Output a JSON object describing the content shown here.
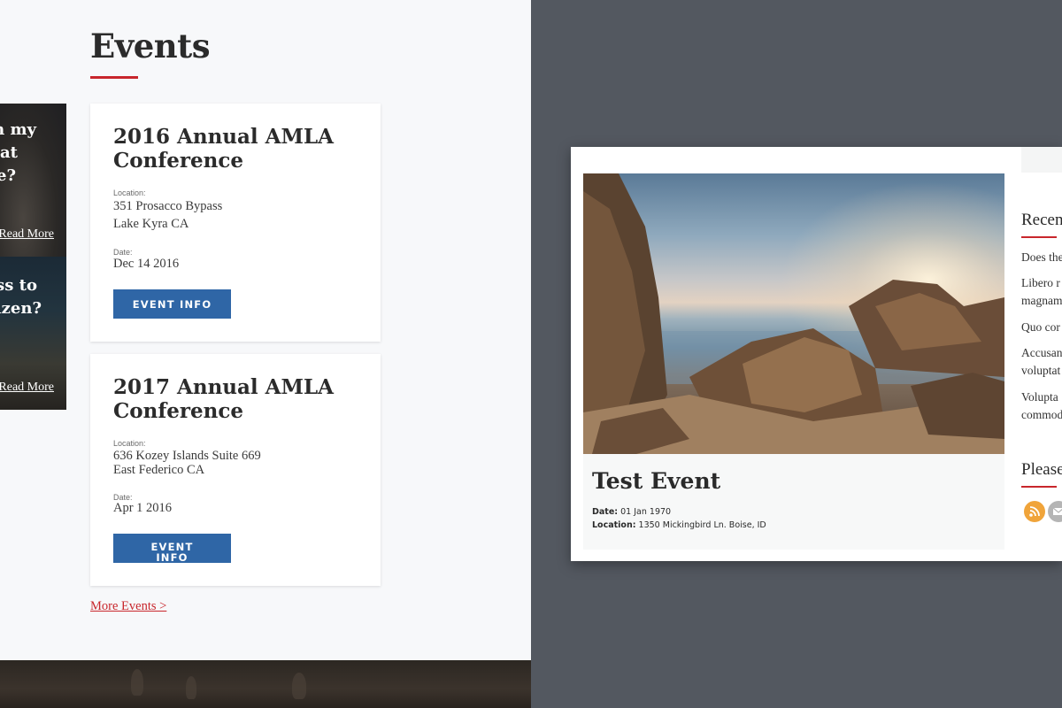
{
  "side_promos": [
    {
      "lines": [
        "n my",
        "at",
        "e?"
      ],
      "link": "Read More"
    },
    {
      "lines": [
        "ss to",
        "izen?"
      ],
      "link": "Read More"
    }
  ],
  "events": {
    "title": "Events",
    "cards": [
      {
        "name": "2016 Annual AMLA Conference",
        "location_label": "Location:",
        "address_line1": "351 Prosacco Bypass",
        "address_line2": "Lake Kyra CA",
        "date_label": "Date:",
        "date": "Dec 14 2016",
        "button": "EVENT INFO"
      },
      {
        "name": "2017 Annual AMLA Conference",
        "location_label": "Location:",
        "address_line1": "636 Kozey Islands Suite 669",
        "address_line2": "East Federico CA",
        "date_label": "Date:",
        "date": "Apr 1 2016",
        "button_line1": "EVENT",
        "button_line2": "INFO"
      }
    ],
    "more_link": "More Events >"
  },
  "detail": {
    "title": "Test Event",
    "date_label": "Date:",
    "date": "01 Jan 1970",
    "location_label": "Location:",
    "location": "1350 Mickingbird Ln. Boise, ID"
  },
  "sidebar": {
    "recent_heading": "Recen",
    "recent_items": [
      "Does the",
      "Libero r",
      "magnam",
      "Quo cor",
      "Accusan",
      "voluptat",
      "Volupta",
      "commod"
    ],
    "please_heading": "Please",
    "icons": [
      {
        "name": "rss-icon",
        "color": "#f0a43a"
      },
      {
        "name": "email-icon",
        "color": "#b5b5b5"
      }
    ]
  },
  "colors": {
    "accent_red": "#c8262c",
    "button_blue": "#2f66a6",
    "backdrop": "#535860"
  }
}
